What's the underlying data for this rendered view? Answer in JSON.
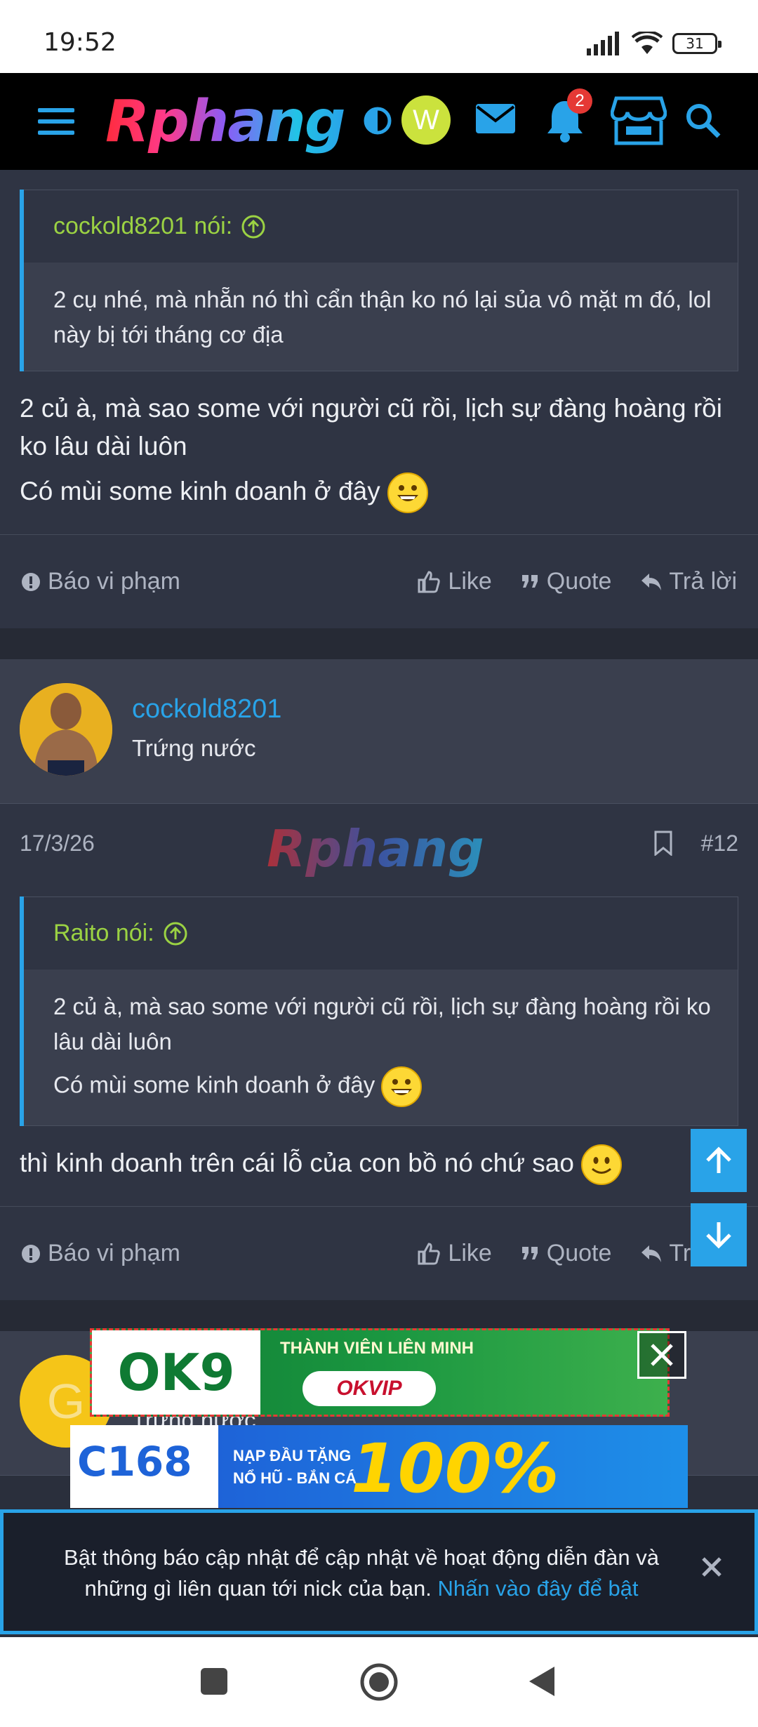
{
  "status_bar": {
    "time": "19:52",
    "battery": "31"
  },
  "header": {
    "logo": "Rphang",
    "avatar_letter": "W",
    "notification_count": "2"
  },
  "post1": {
    "quote_author": "cockold8201 nói:",
    "quote_text": "2 cụ nhé, mà nhẵn nó thì cẩn thận ko nó lại sủa vô mặt m đó, lol này bị tới tháng cơ địa",
    "message_line1": "2 củ à, mà sao some với người cũ rồi, lịch sự đàng hoàng rồi ko lâu dài luôn",
    "message_line2": "Có mùi some kinh doanh ở đây",
    "report": "Báo vi phạm",
    "like": "Like",
    "quote": "Quote",
    "reply": "Trả lời"
  },
  "post2": {
    "username": "cockold8201",
    "role": "Trứng nước",
    "date": "17/3/26",
    "number": "#12",
    "watermark": "Rphang",
    "quote_author": "Raito nói:",
    "quote_line1": "2 củ à, mà sao some với người cũ rồi, lịch sự đàng hoàng rồi ko lâu dài luôn",
    "quote_line2": "Có mùi some kinh doanh ở đây",
    "message": "thì kinh doanh trên cái lỗ của con bồ nó chứ sao",
    "report": "Báo vi phạm",
    "like": "Like",
    "quote": "Quote",
    "reply": "Trả lời"
  },
  "post3": {
    "avatar_letter": "G",
    "role": "Trứng nước"
  },
  "ads": {
    "ad1_brand": "OK9",
    "ad1_text": "THÀNH VIÊN LIÊN MINH",
    "ad1_badge": "OKVIP",
    "ad2_brand": "C168",
    "ad2_small1": "NẠP ĐẦU TẶNG",
    "ad2_small2": "NỔ HŨ - BẮN CÁ",
    "ad2_big": "100%"
  },
  "notice": {
    "text": "Bật thông báo cập nhật để cập nhật về hoạt động diễn đàn và những gì liên quan tới nick của bạn.",
    "link": "Nhấn vào đây để bật"
  },
  "colors": {
    "accent": "#29a3e8",
    "quote_author": "#9bd243",
    "background": "#2f3443"
  }
}
